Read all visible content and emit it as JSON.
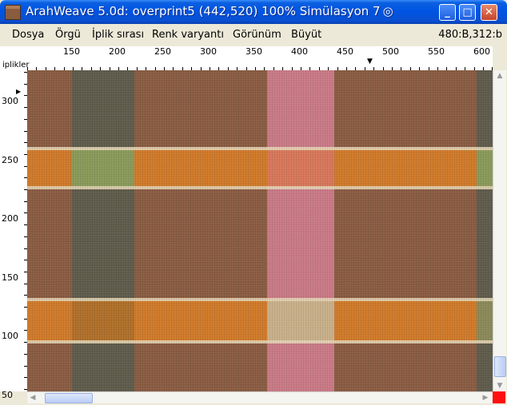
{
  "window": {
    "title": "ArahWeave 5.0d: overprint5 (442,520) 100% Simülasyon 7",
    "swirl_glyph": "@",
    "buttons": {
      "minimize": "_",
      "maximize": "□",
      "close": "✕"
    }
  },
  "menu": {
    "items": [
      "Dosya",
      "Örgü",
      "İplik sırası",
      "Renk varyantı",
      "Görünüm",
      "Büyüt"
    ],
    "coordinates": "480:B,312:b"
  },
  "ruler": {
    "corner_label": "iplikler",
    "x_ticks": [
      "150",
      "200",
      "250",
      "300",
      "350",
      "400",
      "450",
      "500",
      "550",
      "600"
    ],
    "y_ticks": [
      "300",
      "250",
      "200",
      "150",
      "100",
      "50"
    ]
  },
  "colors": {
    "base_brown": "#8a5c42",
    "orange": "#d07a2a",
    "pink": "#c97a86",
    "grey_green": "#5f5c4c",
    "green": "#8a9a5a",
    "cream": "#e8d8b8",
    "cursor_red": "#ff1010"
  }
}
